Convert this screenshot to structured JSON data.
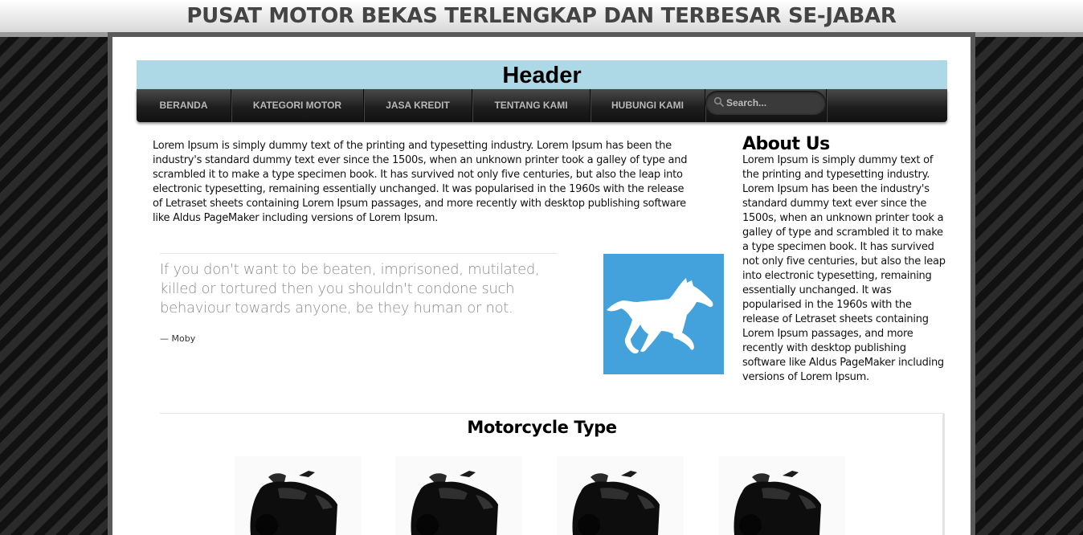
{
  "site_title": "PUSAT MOTOR BEKAS TERLENGKAP DAN TERBESAR SE-JABAR",
  "header": {
    "title": "Header"
  },
  "nav": {
    "items": [
      {
        "label": "BERANDA"
      },
      {
        "label": "KATEGORI MOTOR"
      },
      {
        "label": "JASA KREDIT"
      },
      {
        "label": "TENTANG KAMI"
      },
      {
        "label": "HUBUNGI KAMI"
      }
    ],
    "search_placeholder": "Search...",
    "search_icon": "search-icon"
  },
  "intro": {
    "text": "Lorem Ipsum is simply dummy text of the printing and typesetting industry. Lorem Ipsum has been the industry's standard dummy text ever since the 1500s, when an unknown printer took a galley of type and scrambled it to make a type specimen book. It has survived not only five centuries, but also the leap into electronic typesetting, remaining essentially unchanged. It was popularised in the 1960s with the release of Letraset sheets containing Lorem Ipsum passages, and more recently with desktop publishing software like Aldus PageMaker including versions of Lorem Ipsum."
  },
  "quote": {
    "text": "If you don't want to be beaten, imprisoned, mutilated, killed or tortured then you shouldn't condone such behaviour towards anyone, be they human or not.",
    "author": "— Moby"
  },
  "image_tile": {
    "icon": "horse-icon",
    "background": "#43a2dc"
  },
  "about": {
    "title": "About Us",
    "text": "Lorem Ipsum is simply dummy text of the printing and typesetting industry. Lorem Ipsum has been the industry's standard dummy text ever since the 1500s, when an unknown printer took a galley of type and scrambled it to make a type specimen book. It has survived not only five centuries, but also the leap into electronic typesetting, remaining essentially unchanged. It was popularised in the 1960s with the release of Letraset sheets containing Lorem Ipsum passages, and more recently with desktop publishing software like Aldus PageMaker including versions of Lorem Ipsum."
  },
  "motorcycle_section": {
    "title": "Motorcycle Type",
    "cards": [
      {
        "icon": "motorcycle-image"
      },
      {
        "icon": "motorcycle-image"
      },
      {
        "icon": "motorcycle-image"
      },
      {
        "icon": "motorcycle-image"
      }
    ]
  },
  "colors": {
    "header_banner": "#add8e6",
    "nav_background": "#1e1e1e",
    "nav_text": "#b8b8b8",
    "quote_text": "#8c8c8c"
  }
}
